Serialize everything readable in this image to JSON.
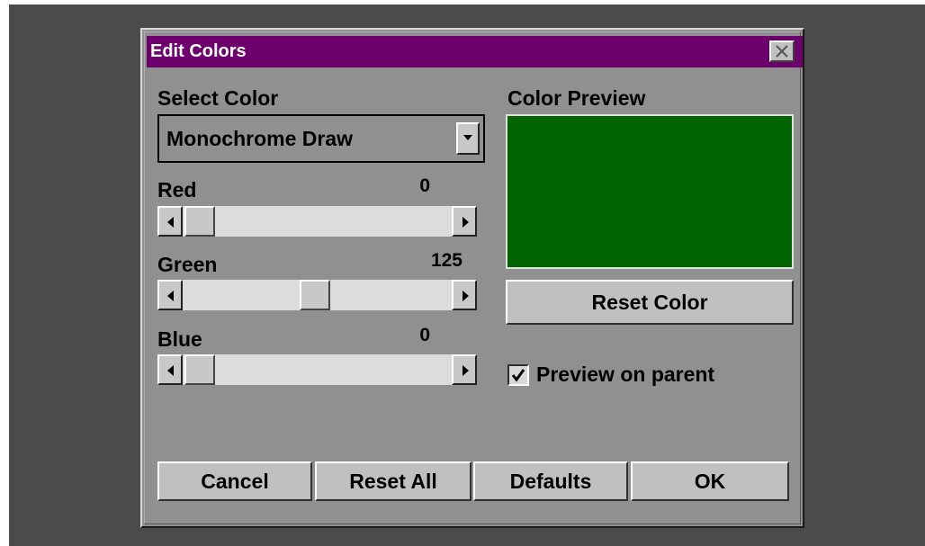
{
  "window": {
    "title": "Edit Colors",
    "title_bar_color": "#6d006d"
  },
  "select_color": {
    "label": "Select Color",
    "selected": "Monochrome Draw"
  },
  "sliders": [
    {
      "label": "Red",
      "value": "0",
      "fraction": 0.0
    },
    {
      "label": "Green",
      "value": "125",
      "fraction": 0.49
    },
    {
      "label": "Blue",
      "value": "0",
      "fraction": 0.0
    }
  ],
  "preview": {
    "label": "Color Preview",
    "color": "#006400"
  },
  "reset_color_label": "Reset Color",
  "preview_on_parent": {
    "label": "Preview on parent",
    "checked": true
  },
  "buttons": {
    "cancel": "Cancel",
    "reset_all": "Reset All",
    "defaults": "Defaults",
    "ok": "OK"
  }
}
